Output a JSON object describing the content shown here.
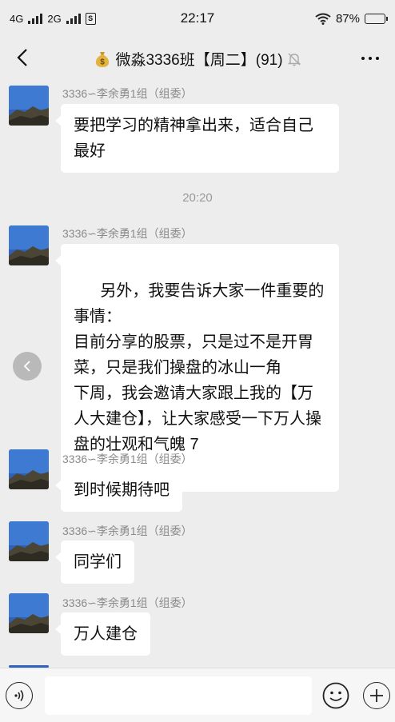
{
  "status_bar": {
    "network_1": "4G",
    "network_2": "2G",
    "time": "22:17",
    "battery": "87%",
    "battery_level": 0.87
  },
  "header": {
    "title": "微淼3336班【周二】(91)",
    "back_icon": "chevron-left-icon",
    "title_icon": "money-bag-icon",
    "mute_icon": "bell-off-icon",
    "more_icon": "more-icon"
  },
  "messages": [
    {
      "sender": "3336∽李余勇1组（组委）",
      "text": "要把学习的精神拿出来，适合自己最好"
    },
    {
      "time_separator": "20:20"
    },
    {
      "sender": "3336∽李余勇1组（组委）",
      "text": "另外，我要告诉大家一件重要的事情：\n目前分享的股票，只是过不是开胃菜，只是我们操盘的冰山一角\n下周，我会邀请大家跟上我的【万人大建仓】，让大家感受一下万人操盘的壮观和气魄 7"
    },
    {
      "sender": "3336∽李余勇1组（组委）",
      "text": "到时候期待吧"
    },
    {
      "sender": "3336∽李余勇1组（组委）",
      "text": "同学们"
    },
    {
      "sender": "3336∽李余勇1组（组委）",
      "text": "万人建仓"
    }
  ],
  "input_bar": {
    "voice_icon": "voice-icon",
    "emoji_icon": "emoji-icon",
    "plus_icon": "plus-icon"
  },
  "colors": {
    "background": "#ededed",
    "bubble": "#ffffff",
    "sender_text": "#8a8a8a"
  }
}
